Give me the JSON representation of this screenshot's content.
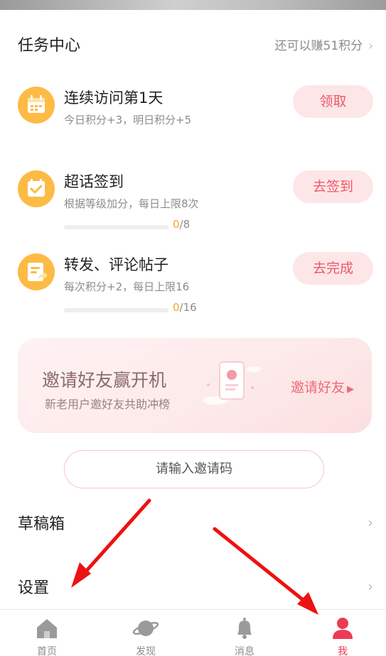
{
  "header": {
    "title": "任务中心",
    "remaining": "还可以赚51积分",
    "chevron_icon": "chevron-right-icon"
  },
  "tasks": [
    {
      "name": "连续访问第1天",
      "desc": "今日积分+3，明日积分+5",
      "button": "领取",
      "icon": "calendar-icon"
    },
    {
      "name": "超话签到",
      "desc": "根据等级加分，每日上限8次",
      "button": "去签到",
      "icon": "checkin-icon",
      "progress_current": "0",
      "progress_total": "/8",
      "progress_fraction": 0
    },
    {
      "name": "转发、评论帖子",
      "desc": "每次积分+2，每日上限16",
      "button": "去完成",
      "icon": "share-doc-icon",
      "progress_current": "0",
      "progress_total": "/16",
      "progress_fraction": 0
    }
  ],
  "invite": {
    "title": "邀请好友赢开机",
    "subtitle": "新老用户邀好友共助冲榜",
    "link": "邀请好友"
  },
  "invite_code": {
    "placeholder": "请输入邀请码"
  },
  "menu": [
    {
      "label": "草稿箱"
    },
    {
      "label": "设置"
    }
  ],
  "tabbar": [
    {
      "label": "首页",
      "icon": "home-icon"
    },
    {
      "label": "发现",
      "icon": "planet-icon"
    },
    {
      "label": "消息",
      "icon": "bell-icon"
    },
    {
      "label": "我",
      "icon": "profile-icon",
      "active": true
    }
  ],
  "colors": {
    "accent": "#ee5866",
    "icon_bg": "#fdbb45",
    "progress": "#f6a623",
    "annotation_arrow": "#ee1111"
  }
}
